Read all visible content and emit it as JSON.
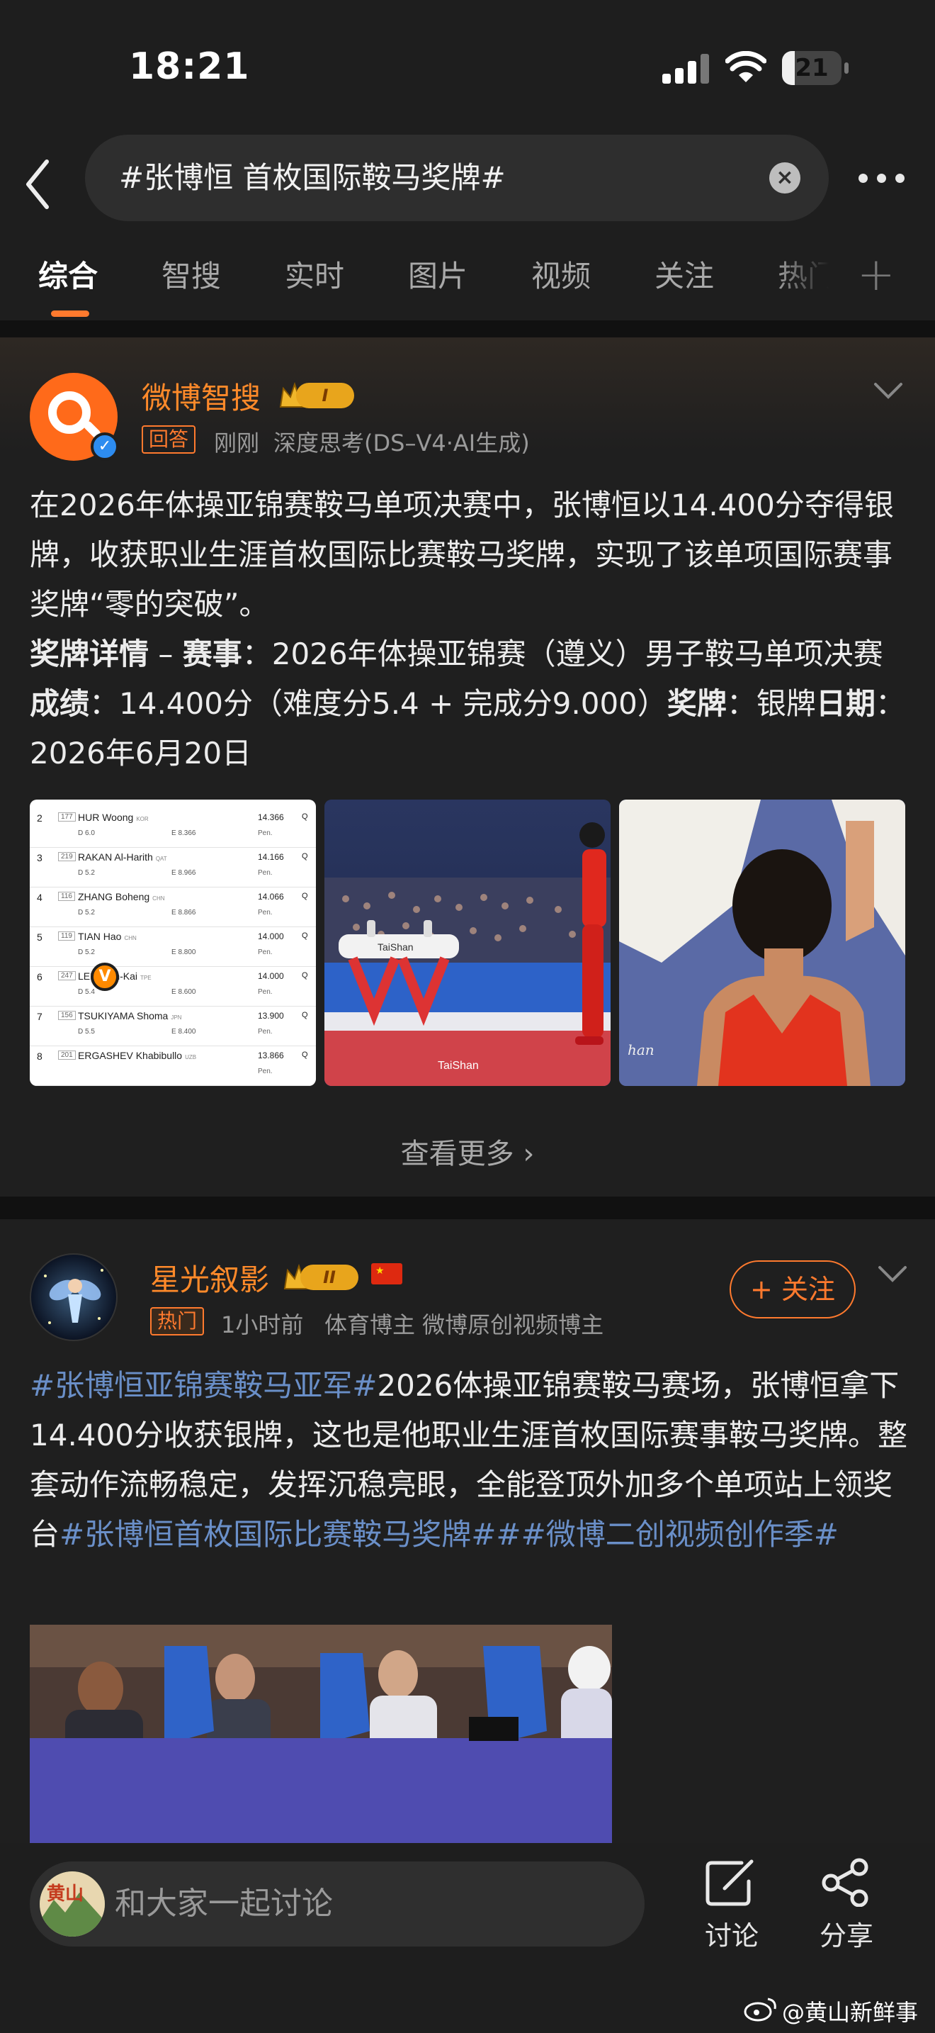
{
  "status_bar": {
    "time": "18:21",
    "battery": "21",
    "battery_fill_fraction": 0.21
  },
  "header": {
    "search_query": "#张博恒 首枚国际鞍马奖牌#",
    "tabs": [
      "综合",
      "智搜",
      "实时",
      "图片",
      "视频",
      "关注",
      "热门"
    ],
    "active_tab_index": 0
  },
  "ai_post": {
    "author": "微博智搜",
    "level": "I",
    "tag": "回答",
    "time": "刚刚",
    "meta": "深度思考(DS–V4·AI生成)",
    "paragraph_1": "在2026年体操亚锦赛鞍马单项决赛中，张博恒以14.400分夺得银牌，收获职业生涯首枚国际比赛鞍马奖牌，实现了该单项国际赛事奖牌“零的突破”。",
    "details": {
      "label_medal_details": "奖牌详情",
      "dash": " – ",
      "label_event": "赛事",
      "event": "：2026年体操亚锦赛（遵义）男子鞍马单项决赛",
      "label_score": "成绩",
      "score": "：14.400分（难度分5.4 + 完成分9.000）",
      "label_medal": "奖牌",
      "medal": "：银牌",
      "label_date": "日期",
      "date": "：2026年6月20日"
    },
    "results_table": [
      {
        "rank": "2",
        "bib": "177",
        "name": "HUR Woong",
        "nat": "KOR",
        "d": "D 6.0",
        "e": "E 8.366",
        "score": "14.366",
        "q": "Q"
      },
      {
        "rank": "3",
        "bib": "219",
        "name": "RAKAN Al-Harith",
        "nat": "QAT",
        "d": "D 5.2",
        "e": "E 8.966",
        "score": "14.166",
        "q": "Q"
      },
      {
        "rank": "4",
        "bib": "116",
        "name": "ZHANG Boheng",
        "nat": "CHN",
        "d": "D 5.2",
        "e": "E 8.866",
        "score": "14.066",
        "q": "Q"
      },
      {
        "rank": "5",
        "bib": "119",
        "name": "TIAN Hao",
        "nat": "CHN",
        "d": "D 5.2",
        "e": "E 8.800",
        "score": "14.000",
        "q": "Q"
      },
      {
        "rank": "6",
        "bib": "247",
        "name": "LEE Chih-Kai",
        "nat": "TPE",
        "d": "D 5.4",
        "e": "E 8.600",
        "score": "14.000",
        "q": "Q"
      },
      {
        "rank": "7",
        "bib": "156",
        "name": "TSUKIYAMA Shoma",
        "nat": "JPN",
        "d": "D 5.5",
        "e": "E 8.400",
        "score": "13.900",
        "q": "Q"
      },
      {
        "rank": "8",
        "bib": "201",
        "name": "ERGASHEV Khabibullo",
        "nat": "UZB",
        "d": "",
        "e": "",
        "score": "13.866",
        "q": "Q"
      }
    ],
    "pen_label": "Pen.",
    "arena_brand": "TaiShan",
    "photo_signature": "han",
    "see_more": "查看更多"
  },
  "user_post": {
    "author": "星光叙影",
    "level": "II",
    "follow_label": "+ 关注",
    "tag": "热门",
    "time": "1小时前",
    "meta": "体育博主 微博原创视频博主",
    "hashtag_1": "#张博恒亚锦赛鞍马亚军#",
    "text": "2026体操亚锦赛鞍马赛场，张博恒拿下14.400分收获银牌，这也是他职业生涯首枚国际赛事鞍马奖牌。整套动作流畅稳定，发挥沉稳亮眼，全能登顶外加多个单项站上领奖台",
    "hashtag_2": "#张博恒首枚国际比赛鞍马奖牌#",
    "hashtag_3": "#微博二创视频创作季#"
  },
  "bottom_bar": {
    "comment_placeholder": "和大家一起讨论",
    "avatar_text": "黄山",
    "discuss_label": "讨论",
    "share_label": "分享",
    "watermark": "@黄山新鲜事"
  },
  "colors": {
    "accent": "#ff7a2e",
    "hashtag": "#6a8fc8",
    "background": "#1f1f1f"
  },
  "icons": [
    "back-icon",
    "clear-icon",
    "more-icon",
    "add-tab-icon",
    "chevron-down-icon",
    "edit-icon",
    "share-icon",
    "weibo-logo-icon"
  ]
}
